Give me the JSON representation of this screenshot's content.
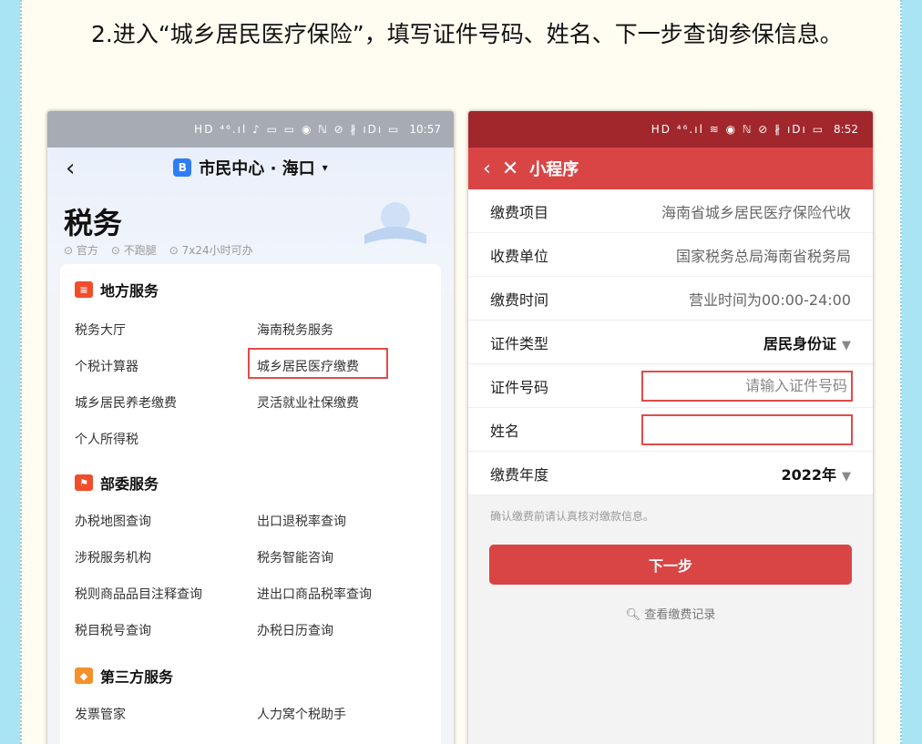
{
  "intro_text": "2.进入“城乡居民医疗保险”，填写证件号码、姓名、下一步查询参保信息。",
  "left_phone": {
    "status_time": "10:57",
    "status_icons": "HD ⁴⁶.ıl ♪ ▭ ▭   ◉ ℕ ⊘ ∦ ıDı ▭",
    "back_icon": "‹",
    "city_badge": "B",
    "city_title": "市民中心 · 海口",
    "city_caret": "▾",
    "page_title": "税务",
    "tags": [
      "官方",
      "不跑腿",
      "7x24小时可办"
    ],
    "sections": [
      {
        "title": "地方服务",
        "items": [
          "税务大厅",
          "海南税务服务",
          "个税计算器",
          "城乡居民医疗缴费",
          "城乡居民养老缴费",
          "灵活就业社保缴费",
          "个人所得税"
        ]
      },
      {
        "title": "部委服务",
        "items": [
          "办税地图查询",
          "出口退税率查询",
          "涉税服务机构",
          "税务智能咨询",
          "税则商品品目注释查询",
          "进出口商品税率查询",
          "税目税号查询",
          "办税日历查询"
        ]
      },
      {
        "title": "第三方服务",
        "items": [
          "发票管家",
          "人力窝个税助手"
        ]
      }
    ],
    "highlighted_item": "城乡居民医疗缴费"
  },
  "right_phone": {
    "status_time": "8:52",
    "status_icons": "HD ⁴⁶.ıl ≋   ◉ ℕ ⊘ ∦ ıDı ▭",
    "nav_back": "‹",
    "nav_close": "✕",
    "nav_title": "小程序",
    "form": {
      "item_label": "缴费项目",
      "item_value": "海南省城乡居民医疗保险代收",
      "unit_label": "收费单位",
      "unit_value": "国家税务总局海南省税务局",
      "time_label": "缴费时间",
      "time_value": "营业时间为00:00-24:00",
      "idtype_label": "证件类型",
      "idtype_value": "居民身份证",
      "idno_label": "证件号码",
      "idno_placeholder": "请输入证件号码",
      "idno_value": "",
      "name_label": "姓名",
      "name_placeholder": "",
      "name_value": "",
      "year_label": "缴费年度",
      "year_value": "2022年"
    },
    "note": "确认缴费前请认真核对缴款信息。",
    "next_button": "下一步",
    "records_link": "查看缴费记录",
    "caret": "▼",
    "search_icon": "🔍︎"
  },
  "colors": {
    "outer_bg": "#a8e4f4",
    "page_bg": "#fffdf1",
    "accent_red": "#d94545",
    "status_red": "#a1272d",
    "highlight_border": "#e24a4a"
  }
}
